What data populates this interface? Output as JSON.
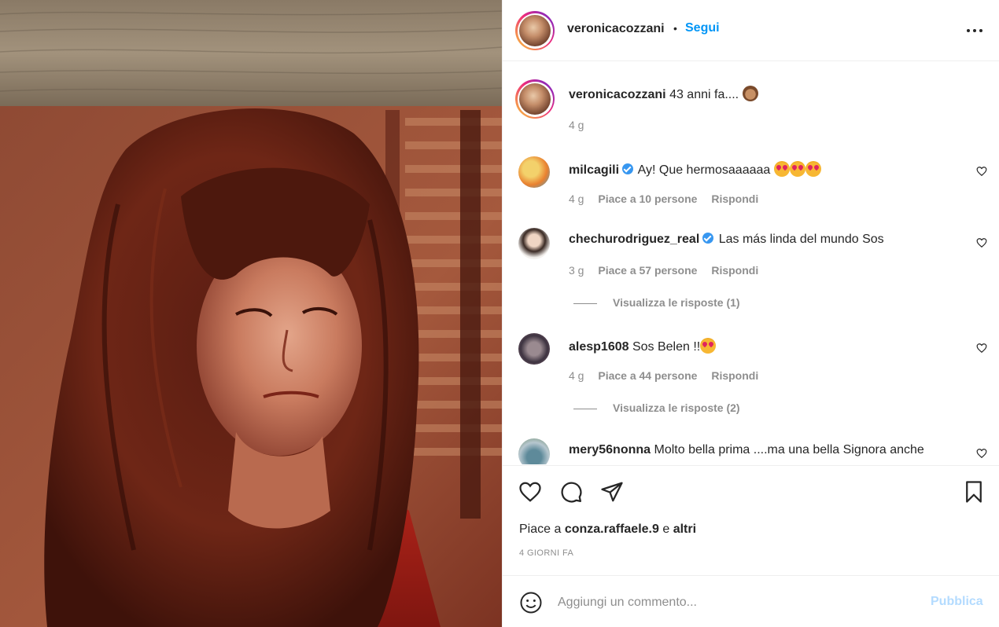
{
  "post": {
    "author": "veronicacozzani",
    "separator": "•",
    "follow_label": "Segui",
    "more_icon": "more-options-icon"
  },
  "caption": {
    "author": "veronicacozzani",
    "text": "43 anni fa....",
    "emoji": "see-no-evil-monkey",
    "time": "4 g"
  },
  "comments": [
    {
      "author": "milcagili",
      "verified": true,
      "text": "Ay! Que hermosaaaaaa",
      "emoji_count": 3,
      "time": "4 g",
      "likes": "Piace a 10 persone",
      "reply": "Rispondi"
    },
    {
      "author": "chechurodriguez_real",
      "verified": true,
      "text": "Las más linda del mundo Sos",
      "time": "3 g",
      "likes": "Piace a 57 persone",
      "reply": "Rispondi",
      "view_replies": "Visualizza le risposte (1)"
    },
    {
      "author": "alesp1608",
      "verified": false,
      "text": "Sos Belen !!",
      "emoji_count": 1,
      "time": "4 g",
      "likes": "Piace a 44 persone",
      "reply": "Rispondi",
      "view_replies": "Visualizza le risposte (2)"
    },
    {
      "author": "mery56nonna",
      "verified": false,
      "text": "Molto bella prima ....ma una bella Signora anche"
    }
  ],
  "actions": {
    "likes_prefix": "Piace a",
    "likes_user": "conza.raffaele.9",
    "likes_and": "e",
    "likes_others": "altri",
    "date": "4 GIORNI FA"
  },
  "add_comment": {
    "placeholder": "Aggiungi un commento...",
    "publish_label": "Pubblica"
  },
  "colors": {
    "link_blue": "#0095f6",
    "muted": "#8e8e8e",
    "text": "#262626",
    "publish_disabled": "#b3dbff",
    "verified": "#3897f0"
  }
}
